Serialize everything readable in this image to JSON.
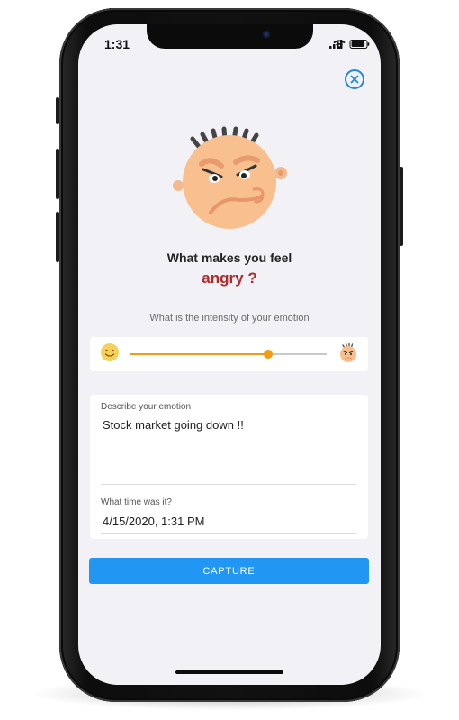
{
  "status_bar": {
    "time": "1:31",
    "icons": [
      "signal-icon",
      "wifi-icon",
      "battery-icon"
    ]
  },
  "header": {
    "close_icon": "close-icon"
  },
  "emotion": {
    "prompt": "What makes you feel",
    "name": "angry ?",
    "face_icon": "angry-face-icon"
  },
  "intensity": {
    "label": "What is the intensity of your emotion",
    "value_percent": 70,
    "min_icon": "happy-face-icon",
    "max_icon": "angry-face-icon"
  },
  "form": {
    "describe_label": "Describe your emotion",
    "describe_value": "Stock market going down !!",
    "time_label": "What time was it?",
    "time_value": "4/15/2020, 1:31 PM"
  },
  "actions": {
    "capture_label": "CAPTURE"
  },
  "colors": {
    "accent": "#2196f3",
    "emotion_text": "#b02a2a",
    "slider": "#f39c12",
    "background": "#f2f2f6"
  }
}
